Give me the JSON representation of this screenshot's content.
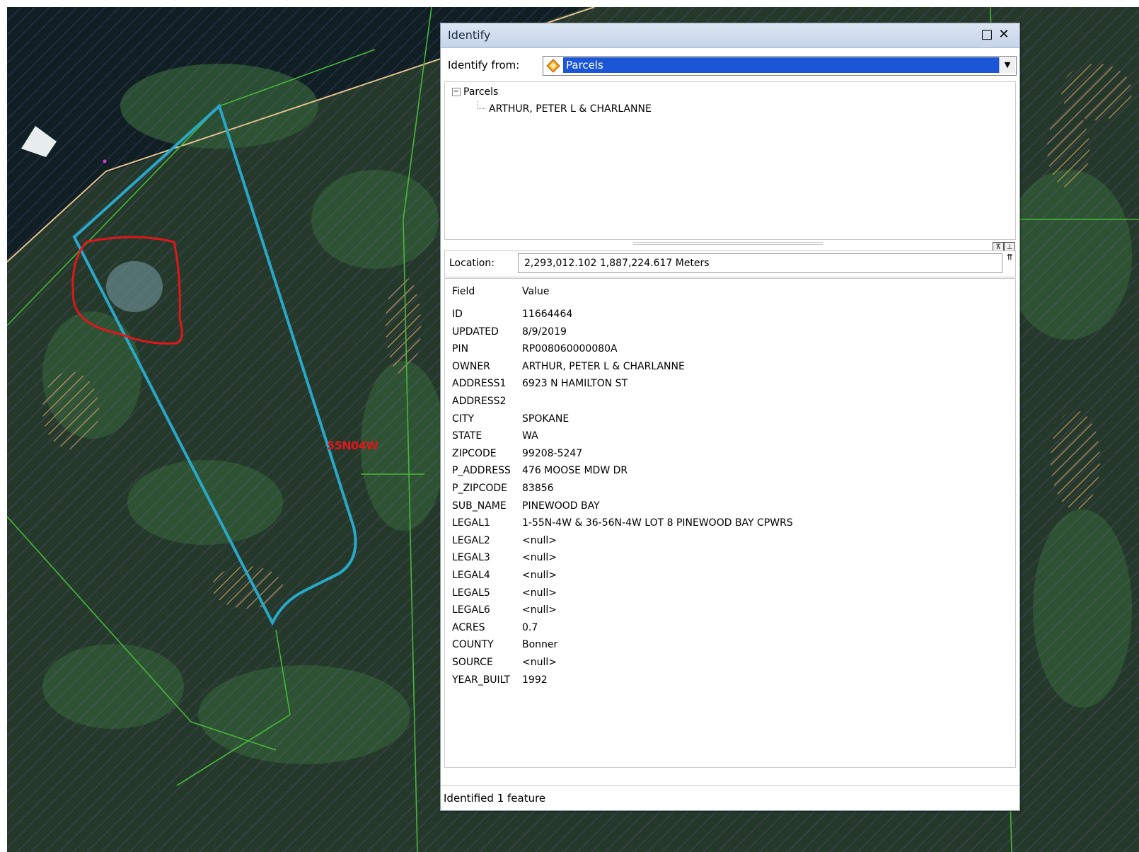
{
  "map": {
    "township_label": "55N04W",
    "colors": {
      "water": "#0f1f23",
      "forest": "#1f3327",
      "parcel_highlight": "#2aa8c9",
      "markup": "#e0171b",
      "parcel_lines": "#49b63c",
      "shoreline": "#e2c08e",
      "hatch": "#8a5ac8"
    }
  },
  "identify": {
    "title": "Identify",
    "maximize_glyph": "□",
    "close_glyph": "✕",
    "from_label": "Identify from:",
    "from_value": "Parcels",
    "dropdown_glyph": "▼",
    "tree": {
      "root_expander": "−",
      "root_label": "Parcels",
      "child_label": "ARTHUR, PETER L & CHARLANNE"
    },
    "splitter_buttons": [
      "⊼",
      "⊥"
    ],
    "location_label": "Location:",
    "location_value": "2,293,012.102  1,887,224.617 Meters",
    "location_scroll_glyph": "⇈",
    "table_header": {
      "field": "Field",
      "value": "Value"
    },
    "rows": [
      {
        "field": "ID",
        "value": "11664464"
      },
      {
        "field": "UPDATED",
        "value": "8/9/2019"
      },
      {
        "field": "PIN",
        "value": "RP008060000080A"
      },
      {
        "field": "OWNER",
        "value": "ARTHUR, PETER L & CHARLANNE"
      },
      {
        "field": "ADDRESS1",
        "value": "6923 N HAMILTON ST"
      },
      {
        "field": "ADDRESS2",
        "value": ""
      },
      {
        "field": "CITY",
        "value": "SPOKANE"
      },
      {
        "field": "STATE",
        "value": "WA"
      },
      {
        "field": "ZIPCODE",
        "value": "99208-5247"
      },
      {
        "field": "P_ADDRESS",
        "value": "476 MOOSE MDW DR"
      },
      {
        "field": "P_ZIPCODE",
        "value": "83856"
      },
      {
        "field": "SUB_NAME",
        "value": "PINEWOOD BAY"
      },
      {
        "field": "LEGAL1",
        "value": "1-55N-4W & 36-56N-4W LOT 8 PINEWOOD BAY CPWRS"
      },
      {
        "field": "LEGAL2",
        "value": "<null>"
      },
      {
        "field": "LEGAL3",
        "value": "<null>"
      },
      {
        "field": "LEGAL4",
        "value": "<null>"
      },
      {
        "field": "LEGAL5",
        "value": "<null>"
      },
      {
        "field": "LEGAL6",
        "value": "<null>"
      },
      {
        "field": "ACRES",
        "value": "0.7"
      },
      {
        "field": "COUNTY",
        "value": "Bonner"
      },
      {
        "field": "SOURCE",
        "value": "<null>"
      },
      {
        "field": "YEAR_BUILT",
        "value": "1992"
      }
    ],
    "status": "Identified 1 feature"
  }
}
